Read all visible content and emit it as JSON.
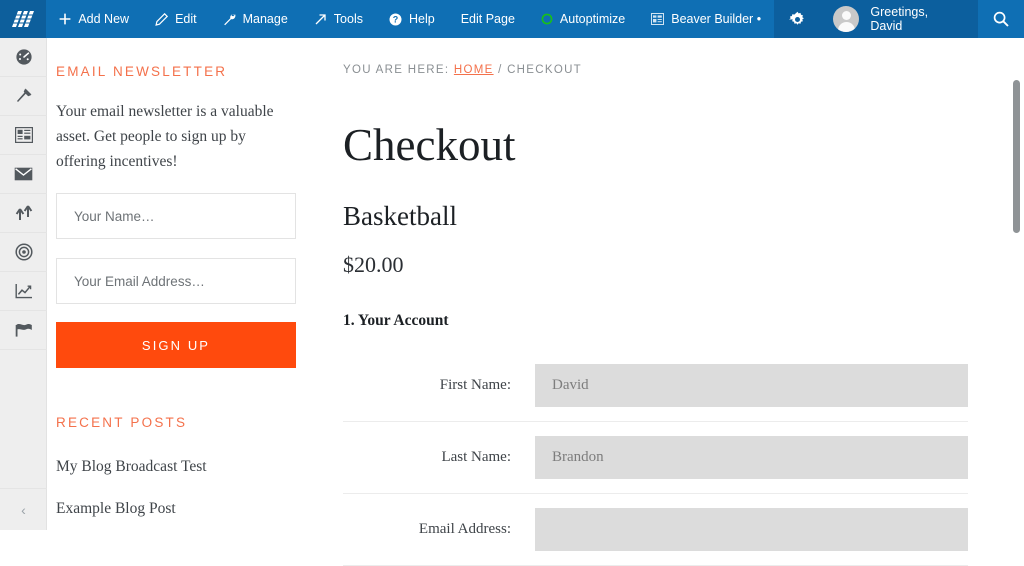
{
  "admin_bar": {
    "logo_icon": "stripes-logo-icon",
    "items": [
      {
        "icon": "plus-icon",
        "label": "Add New"
      },
      {
        "icon": "pencil-icon",
        "label": "Edit"
      },
      {
        "icon": "wrench-icon",
        "label": "Manage"
      },
      {
        "icon": "arrow-up-right-icon",
        "label": "Tools"
      },
      {
        "icon": "question-circle-icon",
        "label": "Help"
      },
      {
        "icon": "",
        "label": "Edit Page"
      },
      {
        "icon": "green-circle-icon",
        "label": "Autoptimize"
      },
      {
        "icon": "grid-icon",
        "label": "Beaver Builder •"
      }
    ],
    "gear_icon": "gear-icon",
    "avatar_icon": "user-avatar-icon",
    "greeting": "Greetings, David",
    "search_icon": "search-icon",
    "bar_color": "#0f6fb4",
    "panel_color": "#0c5f9e"
  },
  "wp_sidebar": {
    "items": [
      {
        "icon": "dashboard-gauge-icon",
        "name": "dashboard"
      },
      {
        "icon": "pushpin-icon",
        "name": "posts"
      },
      {
        "icon": "grid-layout-icon",
        "name": "pages"
      },
      {
        "icon": "envelope-icon",
        "name": "mail"
      },
      {
        "icon": "arrows-up-down-icon",
        "name": "transfer"
      },
      {
        "icon": "target-icon",
        "name": "targeting"
      },
      {
        "icon": "chart-line-icon",
        "name": "analytics"
      },
      {
        "icon": "flag-icon",
        "name": "milestones"
      }
    ],
    "collapse_label": "‹"
  },
  "newsletter_widget": {
    "title": "EMAIL NEWSLETTER",
    "body": "Your email newsletter is a valuable asset. Get people to sign up by offering incentives!",
    "name_placeholder": "Your Name…",
    "name_value": "",
    "email_placeholder": "Your Email Address…",
    "email_value": "",
    "button_label": "SIGN UP",
    "button_color": "#ff4a0d"
  },
  "recent_posts_widget": {
    "title": "RECENT POSTS",
    "posts": [
      "My Blog Broadcast Test",
      "Example Blog Post"
    ]
  },
  "main": {
    "breadcrumb_prefix": "YOU ARE HERE:",
    "breadcrumb_home": "HOME",
    "breadcrumb_separator": "/",
    "breadcrumb_current": "CHECKOUT",
    "page_title": "Checkout",
    "product_name": "Basketball",
    "product_price": "$20.00",
    "section_heading": "1. Your Account",
    "fields": [
      {
        "label": "First Name:",
        "value": "David"
      },
      {
        "label": "Last Name:",
        "value": "Brandon"
      },
      {
        "label": "Email Address:",
        "value": ""
      }
    ],
    "accent_color": "#f4714b"
  }
}
